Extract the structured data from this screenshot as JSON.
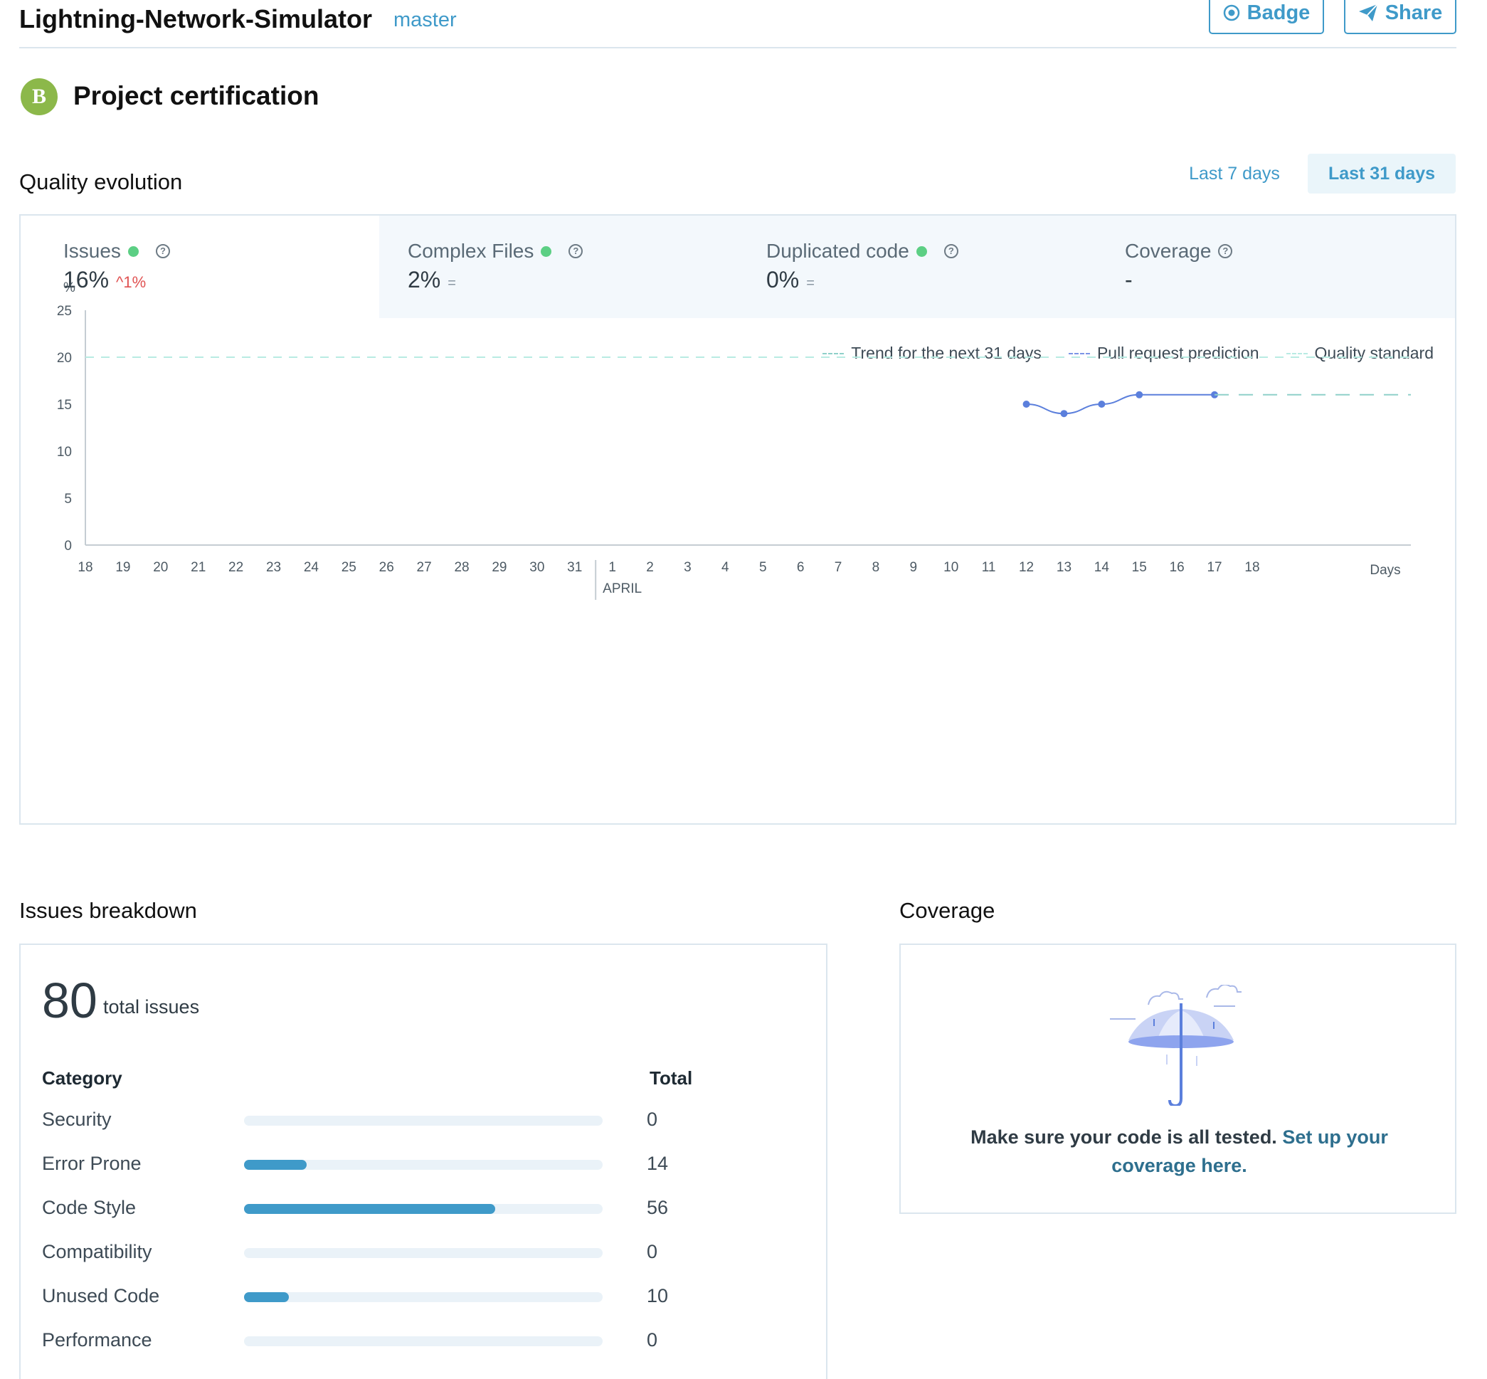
{
  "header": {
    "repo_name": "Lightning-Network-Simulator",
    "branch": "master",
    "badge_label": "Badge",
    "share_label": "Share"
  },
  "certification": {
    "grade": "B",
    "grade_color": "#8cb84a",
    "title": "Project certification"
  },
  "quality_evolution": {
    "title": "Quality evolution",
    "range_options": [
      "Last 7 days",
      "Last 31 days"
    ],
    "selected_range": "Last 31 days",
    "tabs": [
      {
        "label": "Issues",
        "value": "16%",
        "delta": "^1%",
        "status": "green",
        "active": true
      },
      {
        "label": "Complex Files",
        "value": "2%",
        "delta": "=",
        "status": "green",
        "active": false
      },
      {
        "label": "Duplicated code",
        "value": "0%",
        "delta": "=",
        "status": "green",
        "active": false
      },
      {
        "label": "Coverage",
        "value": "-",
        "delta": "",
        "status": "",
        "active": false
      }
    ],
    "legend": [
      {
        "label": "Trend for the next 31 days",
        "color": "#8fd0c9"
      },
      {
        "label": "Pull request prediction",
        "color": "#7c95e6"
      },
      {
        "label": "Quality standard",
        "color": "#b9ebe3"
      }
    ]
  },
  "chart_data": {
    "type": "line",
    "ylabel": "%",
    "xlabel": "Days",
    "ylim": [
      0,
      25
    ],
    "yticks": [
      0,
      5,
      10,
      15,
      20,
      25
    ],
    "x_ticks": [
      "18",
      "19",
      "20",
      "21",
      "22",
      "23",
      "24",
      "25",
      "26",
      "27",
      "28",
      "29",
      "30",
      "31",
      "1",
      "2",
      "3",
      "4",
      "5",
      "6",
      "7",
      "8",
      "9",
      "10",
      "11",
      "12",
      "13",
      "14",
      "15",
      "16",
      "17",
      "18"
    ],
    "month_label": "APRIL",
    "month_start_index": 14,
    "quality_standard": 20,
    "series": [
      {
        "x": [
          "12",
          "13",
          "14",
          "15",
          "17"
        ],
        "x_index": [
          25,
          26,
          27,
          28,
          30
        ],
        "values": [
          15,
          14,
          15,
          16,
          16
        ],
        "color": "#5b7fdc"
      }
    ],
    "trend": {
      "value": 16,
      "from_index": 30,
      "color": "#8fd0c9"
    }
  },
  "issues_breakdown": {
    "title": "Issues breakdown",
    "total": "80",
    "total_label": "total issues",
    "category_header": "Category",
    "total_header": "Total",
    "max": 80,
    "categories": [
      {
        "name": "Security",
        "total": "0",
        "value": 0
      },
      {
        "name": "Error Prone",
        "total": "14",
        "value": 14
      },
      {
        "name": "Code Style",
        "total": "56",
        "value": 56
      },
      {
        "name": "Compatibility",
        "total": "0",
        "value": 0
      },
      {
        "name": "Unused Code",
        "total": "10",
        "value": 10
      },
      {
        "name": "Performance",
        "total": "0",
        "value": 0
      }
    ]
  },
  "coverage": {
    "title": "Coverage",
    "message": "Make sure your code is all tested.",
    "link_text": "Set up your coverage here."
  }
}
